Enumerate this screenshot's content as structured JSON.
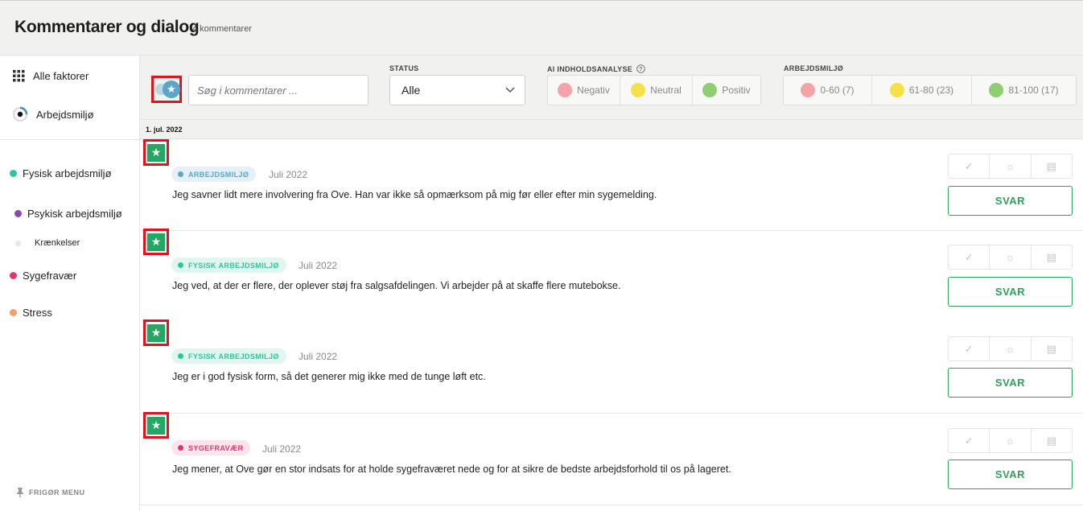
{
  "header": {
    "title": "Kommentarer og dialog",
    "count": "4 kommentarer"
  },
  "sidebar": {
    "top_items": [
      {
        "label": "Alle faktorer",
        "icon": "grid-icon"
      },
      {
        "label": "Arbejdsmiljø",
        "icon": "target-icon"
      }
    ],
    "factors": [
      {
        "label": "Fysisk arbejdsmiljø",
        "color": "#2ec4a0"
      },
      {
        "label": "Psykisk arbejdsmiljø",
        "color": "#8a4aa8"
      },
      {
        "label": "Krænkelser",
        "color": "#e8e8e8"
      },
      {
        "label": "Sygefravær",
        "color": "#e0356f"
      },
      {
        "label": "Stress",
        "color": "#f0a06a"
      }
    ],
    "free_menu": "FRIGØR MENU"
  },
  "filters": {
    "search_placeholder": "Søg i kommentarer ...",
    "status_label": "STATUS",
    "status_value": "Alle",
    "ai_label": "AI INDHOLDSANALYSE",
    "ai_options": [
      {
        "label": "Negativ",
        "color": "#f4a3a8"
      },
      {
        "label": "Neutral",
        "color": "#f5e04a"
      },
      {
        "label": "Positiv",
        "color": "#8fcf72"
      }
    ],
    "env_label": "ARBEJDSMILJØ",
    "env_options": [
      {
        "label": "0-60 (7)",
        "color": "#f4a3a8"
      },
      {
        "label": "61-80 (23)",
        "color": "#f5e04a"
      },
      {
        "label": "81-100 (17)",
        "color": "#8fcf72"
      }
    ]
  },
  "date_group": "1. jul. 2022",
  "comments": [
    {
      "tag": "ARBEJDSMILJØ",
      "tag_color": "#5aa5c8",
      "tag_bg": "#e5f1f7",
      "date": "Juli 2022",
      "text": "Jeg savner lidt mere involvering fra Ove. Han var ikke så opmærksom på mig før eller efter min sygemelding.",
      "reply": "SVAR"
    },
    {
      "tag": "FYSISK ARBEJDSMILJØ",
      "tag_color": "#2ec4a0",
      "tag_bg": "#e2f6f0",
      "date": "Juli 2022",
      "text": "Jeg ved, at der er flere, der oplever støj fra salgsafdelingen. Vi arbejder på at skaffe flere mutebokse.",
      "reply": "SVAR"
    },
    {
      "tag": "FYSISK ARBEJDSMILJØ",
      "tag_color": "#2ec4a0",
      "tag_bg": "#e2f6f0",
      "date": "Juli 2022",
      "text": "Jeg er i god fysisk form, så det generer mig ikke med de tunge løft etc.",
      "reply": "SVAR"
    },
    {
      "tag": "SYGEFRAVÆR",
      "tag_color": "#e0356f",
      "tag_bg": "#fbe4ec",
      "date": "Juli 2022",
      "text": "Jeg mener, at Ove gør en stor indsats for at holde sygefraværet nede og for at sikre de bedste arbejdsforhold til os på lageret.",
      "reply": "SVAR"
    }
  ]
}
